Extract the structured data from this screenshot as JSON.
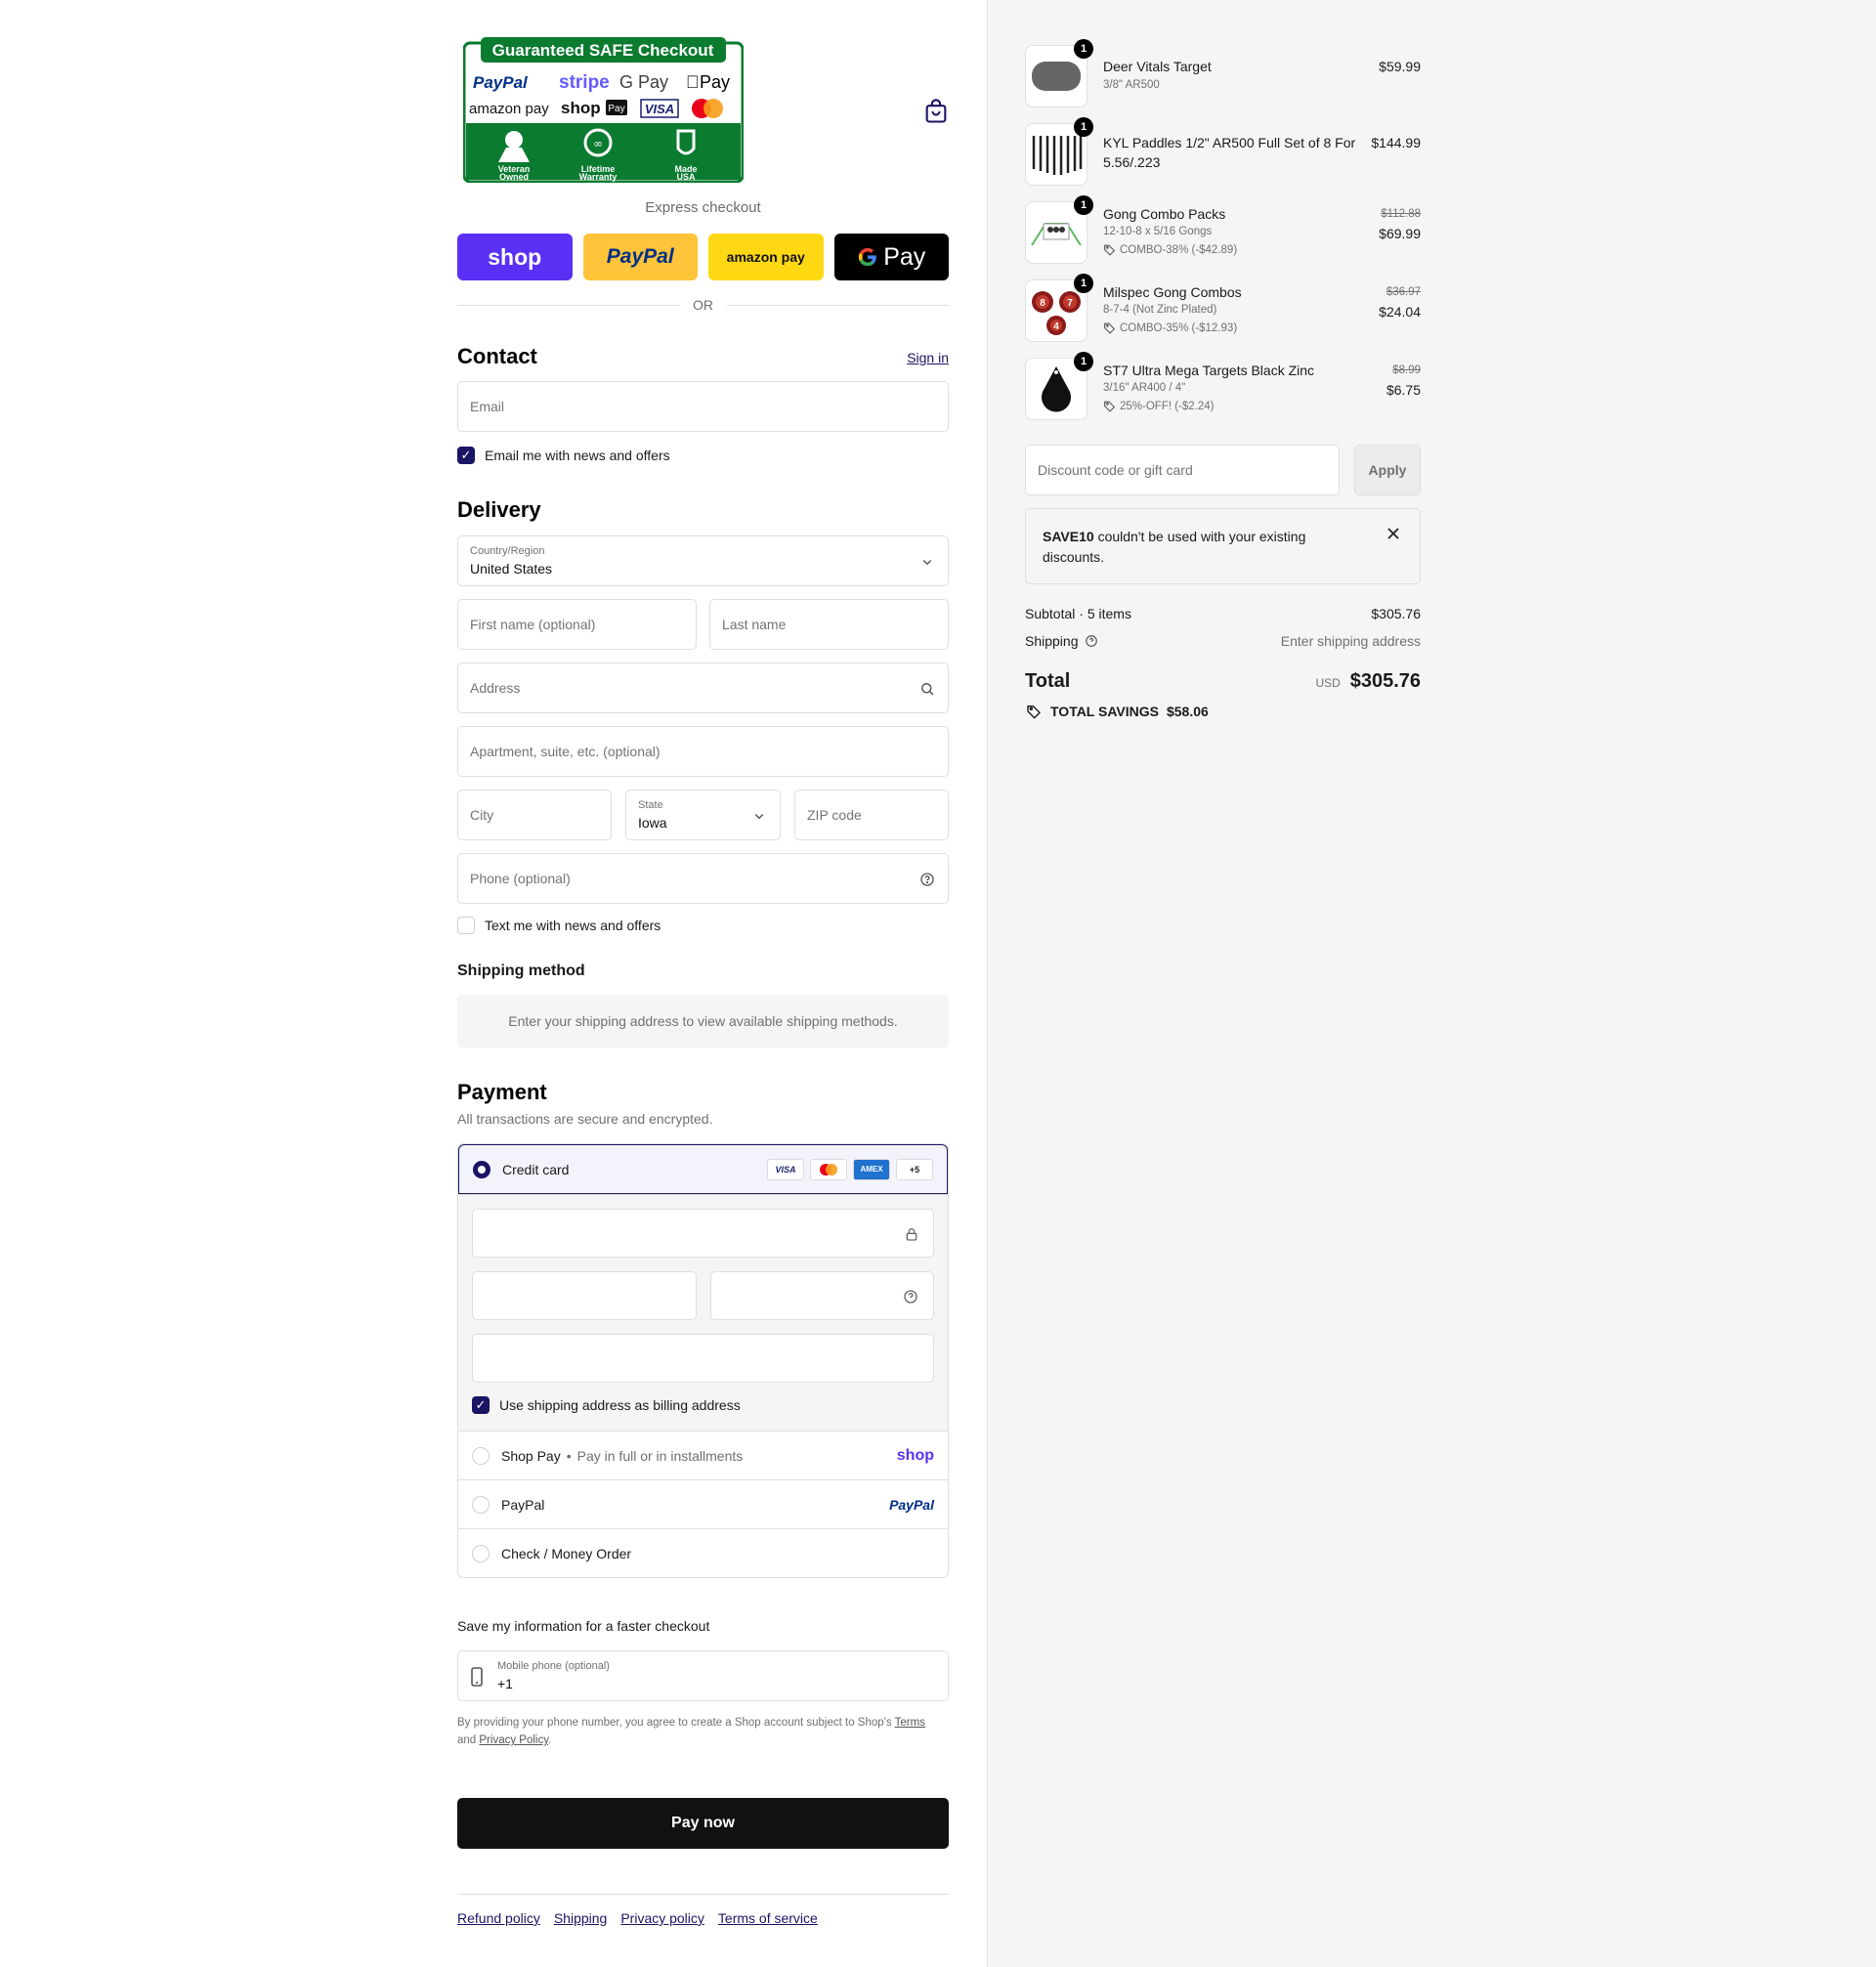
{
  "badge": {
    "title": "Guaranteed SAFE Checkout",
    "row1": [
      "PayPal",
      "stripe",
      "G Pay",
      "Pay"
    ],
    "row2": [
      "amazon pay",
      "shop",
      "Pay",
      "VISA"
    ],
    "features": [
      "Veteran Owned",
      "Lifetime Warranty",
      "Made USA"
    ]
  },
  "express": {
    "title": "Express checkout",
    "shop": "shop",
    "paypal": "PayPal",
    "amazon": "amazon pay",
    "gpay": "Pay",
    "or": "OR"
  },
  "contact": {
    "title": "Contact",
    "signin": "Sign in",
    "email_placeholder": "Email",
    "news_label": "Email me with news and offers"
  },
  "delivery": {
    "title": "Delivery",
    "country_label": "Country/Region",
    "country_value": "United States",
    "first_name": "First name (optional)",
    "last_name": "Last name",
    "address": "Address",
    "apartment": "Apartment, suite, etc. (optional)",
    "city": "City",
    "state_label": "State",
    "state_value": "Iowa",
    "zip": "ZIP code",
    "phone": "Phone (optional)",
    "text_label": "Text me with news and offers"
  },
  "shipping": {
    "title": "Shipping method",
    "message": "Enter your shipping address to view available shipping methods."
  },
  "payment": {
    "title": "Payment",
    "subtitle": "All transactions are secure and encrypted.",
    "credit_card": "Credit card",
    "cards": [
      "VISA",
      "",
      "AMEX",
      "+5"
    ],
    "billing_label": "Use shipping address as billing address",
    "shop_pay": "Shop Pay",
    "shop_pay_sub": "Pay in full or in installments",
    "shop_logo": "shop",
    "paypal": "PayPal",
    "paypal_logo": "PayPal",
    "check": "Check / Money Order"
  },
  "save": {
    "title": "Save my information for a faster checkout",
    "mobile_label": "Mobile phone (optional)",
    "mobile_value": "+1",
    "legal_1": "By providing your phone number, you agree to create a Shop account subject to Shop's ",
    "terms": "Terms",
    "legal_2": "and ",
    "privacy": "Privacy Policy",
    "legal_3": "."
  },
  "pay_now": "Pay now",
  "footer": [
    "Refund policy",
    "Shipping",
    "Privacy policy",
    "Terms of service"
  ],
  "items": [
    {
      "qty": "1",
      "name": "Deer Vitals Target",
      "sub": "3/8\" AR500",
      "price": "$59.99",
      "orig": "",
      "disc": ""
    },
    {
      "qty": "1",
      "name": "KYL Paddles 1/2\" AR500 Full Set of 8 For 5.56/.223",
      "sub": "",
      "price": "$144.99",
      "orig": "",
      "disc": ""
    },
    {
      "qty": "1",
      "name": "Gong Combo Packs",
      "sub": "12-10-8 x 5/16 Gongs",
      "price": "$69.99",
      "orig": "$112.88",
      "disc": "COMBO-38% (-$42.89)"
    },
    {
      "qty": "1",
      "name": "Milspec Gong Combos",
      "sub": "8-7-4 (Not Zinc Plated)",
      "price": "$24.04",
      "orig": "$36.97",
      "disc": "COMBO-35% (-$12.93)"
    },
    {
      "qty": "1",
      "name": "ST7 Ultra Mega Targets Black Zinc",
      "sub": "3/16\" AR400 / 4\"",
      "price": "$6.75",
      "orig": "$8.99",
      "disc": "25%-OFF! (-$2.24)"
    }
  ],
  "gong_numbers": [
    "8",
    "7",
    "4"
  ],
  "discount": {
    "placeholder": "Discount code or gift card",
    "apply": "Apply",
    "notice_code": "SAVE10",
    "notice_text": "couldn't be used with your existing discounts."
  },
  "summary": {
    "subtotal_label": "Subtotal · 5 items",
    "subtotal_value": "$305.76",
    "shipping_label": "Shipping",
    "shipping_value": "Enter shipping address",
    "total_label": "Total",
    "currency": "USD",
    "total_value": "$305.76",
    "savings_label": "TOTAL SAVINGS",
    "savings_value": "$58.06"
  },
  "colors": {
    "accent": "#1a1464",
    "shop_purple": "#5a31f4",
    "paypal_yellow": "#ffc439",
    "amazon_yellow": "#ffd814",
    "badge_green": "#0a7b2f"
  }
}
